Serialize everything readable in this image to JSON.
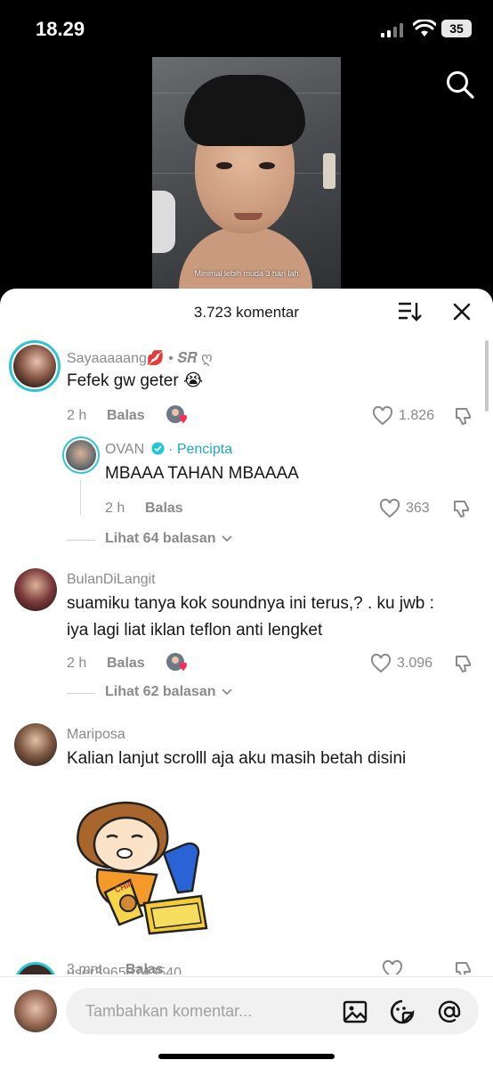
{
  "status_bar": {
    "time": "18.29",
    "battery": "35"
  },
  "video": {
    "caption": "Minimal lebih muda 3 hari lah"
  },
  "sheet": {
    "title": "3.723 komentar"
  },
  "comments": [
    {
      "username": "Sayaaaaang💋 • 𝑺𝑹 ღ",
      "text": "Fefek gw geter 😭",
      "time": "2 h",
      "reply_label": "Balas",
      "likes": "1.826",
      "reply": {
        "username": "OVAN",
        "badge": "· Pencipta",
        "text": "MBAAA TAHAN MBAAAA",
        "time": "2 h",
        "reply_label": "Balas",
        "likes": "363"
      },
      "view_replies": "Lihat 64 balasan"
    },
    {
      "username": "BulanDiLangit",
      "text_line1": "suamiku tanya kok soundnya ini terus,? . ku jwb :",
      "text_line2": "iya lagi liat iklan teflon anti lengket",
      "time": "2 h",
      "reply_label": "Balas",
      "likes": "3.096",
      "view_replies": "Lihat 62 balasan"
    },
    {
      "username": "Mariposa",
      "text": "Kalian lanjut scrolll aja aku masih betah disini",
      "sticker_text": "CHIP",
      "time": "3 mnt",
      "reply_label": "Balas",
      "likes": ""
    },
    {
      "username": "user39658743540"
    }
  ],
  "composer": {
    "placeholder": "Tambahkan komentar..."
  }
}
